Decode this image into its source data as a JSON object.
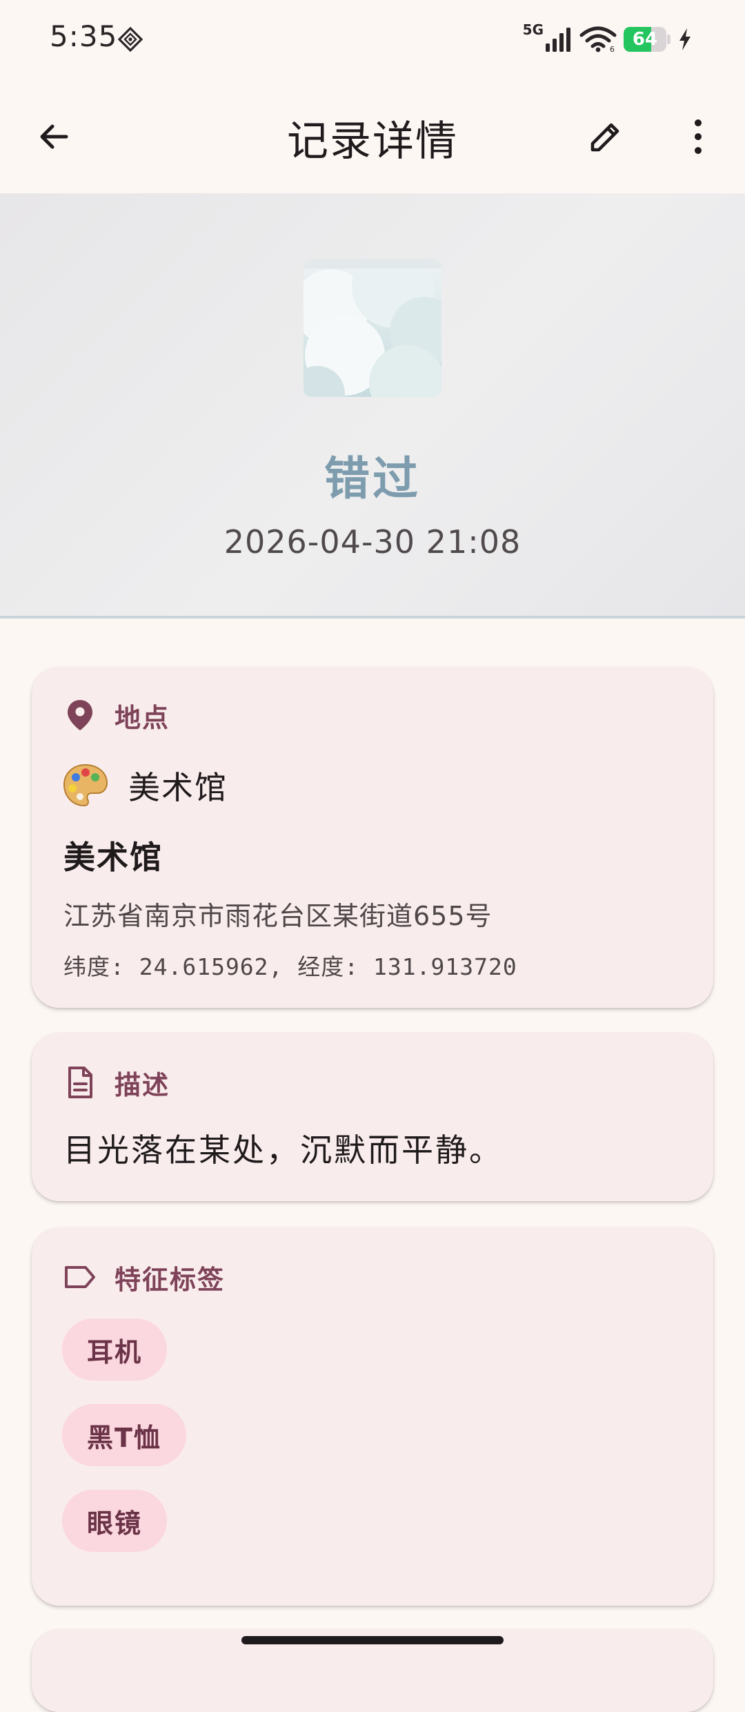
{
  "status_bar": {
    "time": "5:35",
    "network_type": "5G",
    "battery_level": "64",
    "battery_fraction": 0.64,
    "charging": true
  },
  "app_bar": {
    "title": "记录详情",
    "back_icon": "arrow-back-icon",
    "edit_icon": "pencil-icon",
    "more_icon": "more-vert-icon"
  },
  "hero": {
    "image": "clouds-image",
    "name": "错过",
    "datetime": "2026-04-30 21:08"
  },
  "location_card": {
    "header_label": "地点",
    "header_icon": "location-pin-icon",
    "category_icon": "artist-palette-icon",
    "category": "美术馆",
    "name": "美术馆",
    "address": "江苏省南京市雨花台区某街道655号",
    "coordinates": "纬度: 24.615962, 经度: 131.913720"
  },
  "description_card": {
    "header_label": "描述",
    "header_icon": "document-icon",
    "text": "目光落在某处，沉默而平静。"
  },
  "tags_card": {
    "header_label": "特征标签",
    "header_icon": "label-icon",
    "tags": [
      "耳机",
      "黑T恤",
      "眼镜"
    ]
  },
  "colors": {
    "background": "#fdf7f4",
    "card": "#f9ecec",
    "accent": "#7e4359",
    "chip": "#fbd7df",
    "hero_name": "#7d9cae"
  }
}
